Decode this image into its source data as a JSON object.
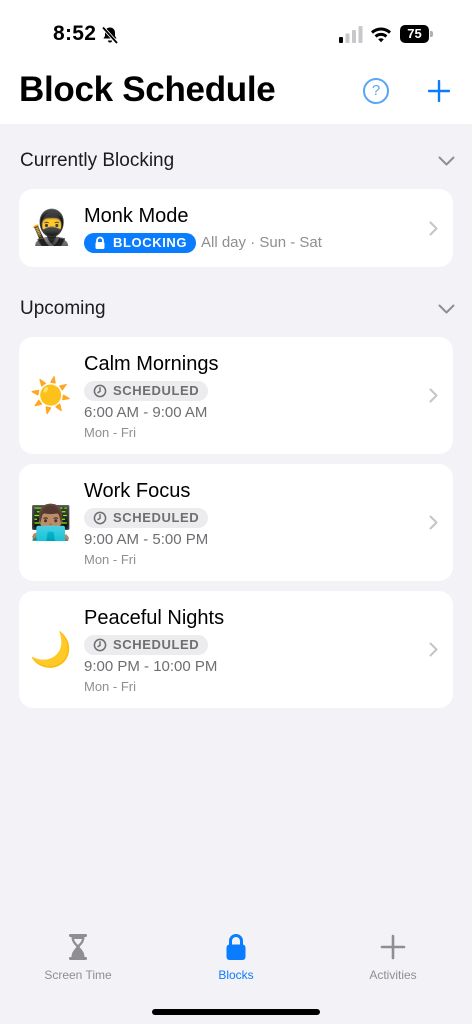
{
  "status_bar": {
    "time": "8:52",
    "battery": "75"
  },
  "header": {
    "title": "Block Schedule",
    "help_label": "?"
  },
  "sections": {
    "current": {
      "title": "Currently Blocking"
    },
    "upcoming": {
      "title": "Upcoming"
    }
  },
  "current_block": {
    "emoji": "🥷",
    "title": "Monk Mode",
    "badge": "BLOCKING",
    "info": "All day · Sun - Sat"
  },
  "upcoming_blocks": [
    {
      "emoji": "☀️",
      "title": "Calm Mornings",
      "badge": "SCHEDULED",
      "time": "6:00 AM - 9:00 AM",
      "days": "Mon - Fri"
    },
    {
      "emoji": "👨🏽‍💻",
      "title": "Work Focus",
      "badge": "SCHEDULED",
      "time": "9:00 AM - 5:00 PM",
      "days": "Mon - Fri"
    },
    {
      "emoji": "🌙",
      "title": "Peaceful Nights",
      "badge": "SCHEDULED",
      "time": "9:00 PM - 10:00 PM",
      "days": "Mon - Fri"
    }
  ],
  "tab_bar": {
    "tabs": [
      {
        "label": "Screen Time",
        "icon": "hourglass-icon",
        "active": false
      },
      {
        "label": "Blocks",
        "icon": "lock-icon",
        "active": true
      },
      {
        "label": "Activities",
        "icon": "plus-icon",
        "active": false
      }
    ]
  },
  "colors": {
    "accent": "#0a7cff",
    "inactive": "#8e8e93",
    "background": "#f2f2f7"
  }
}
